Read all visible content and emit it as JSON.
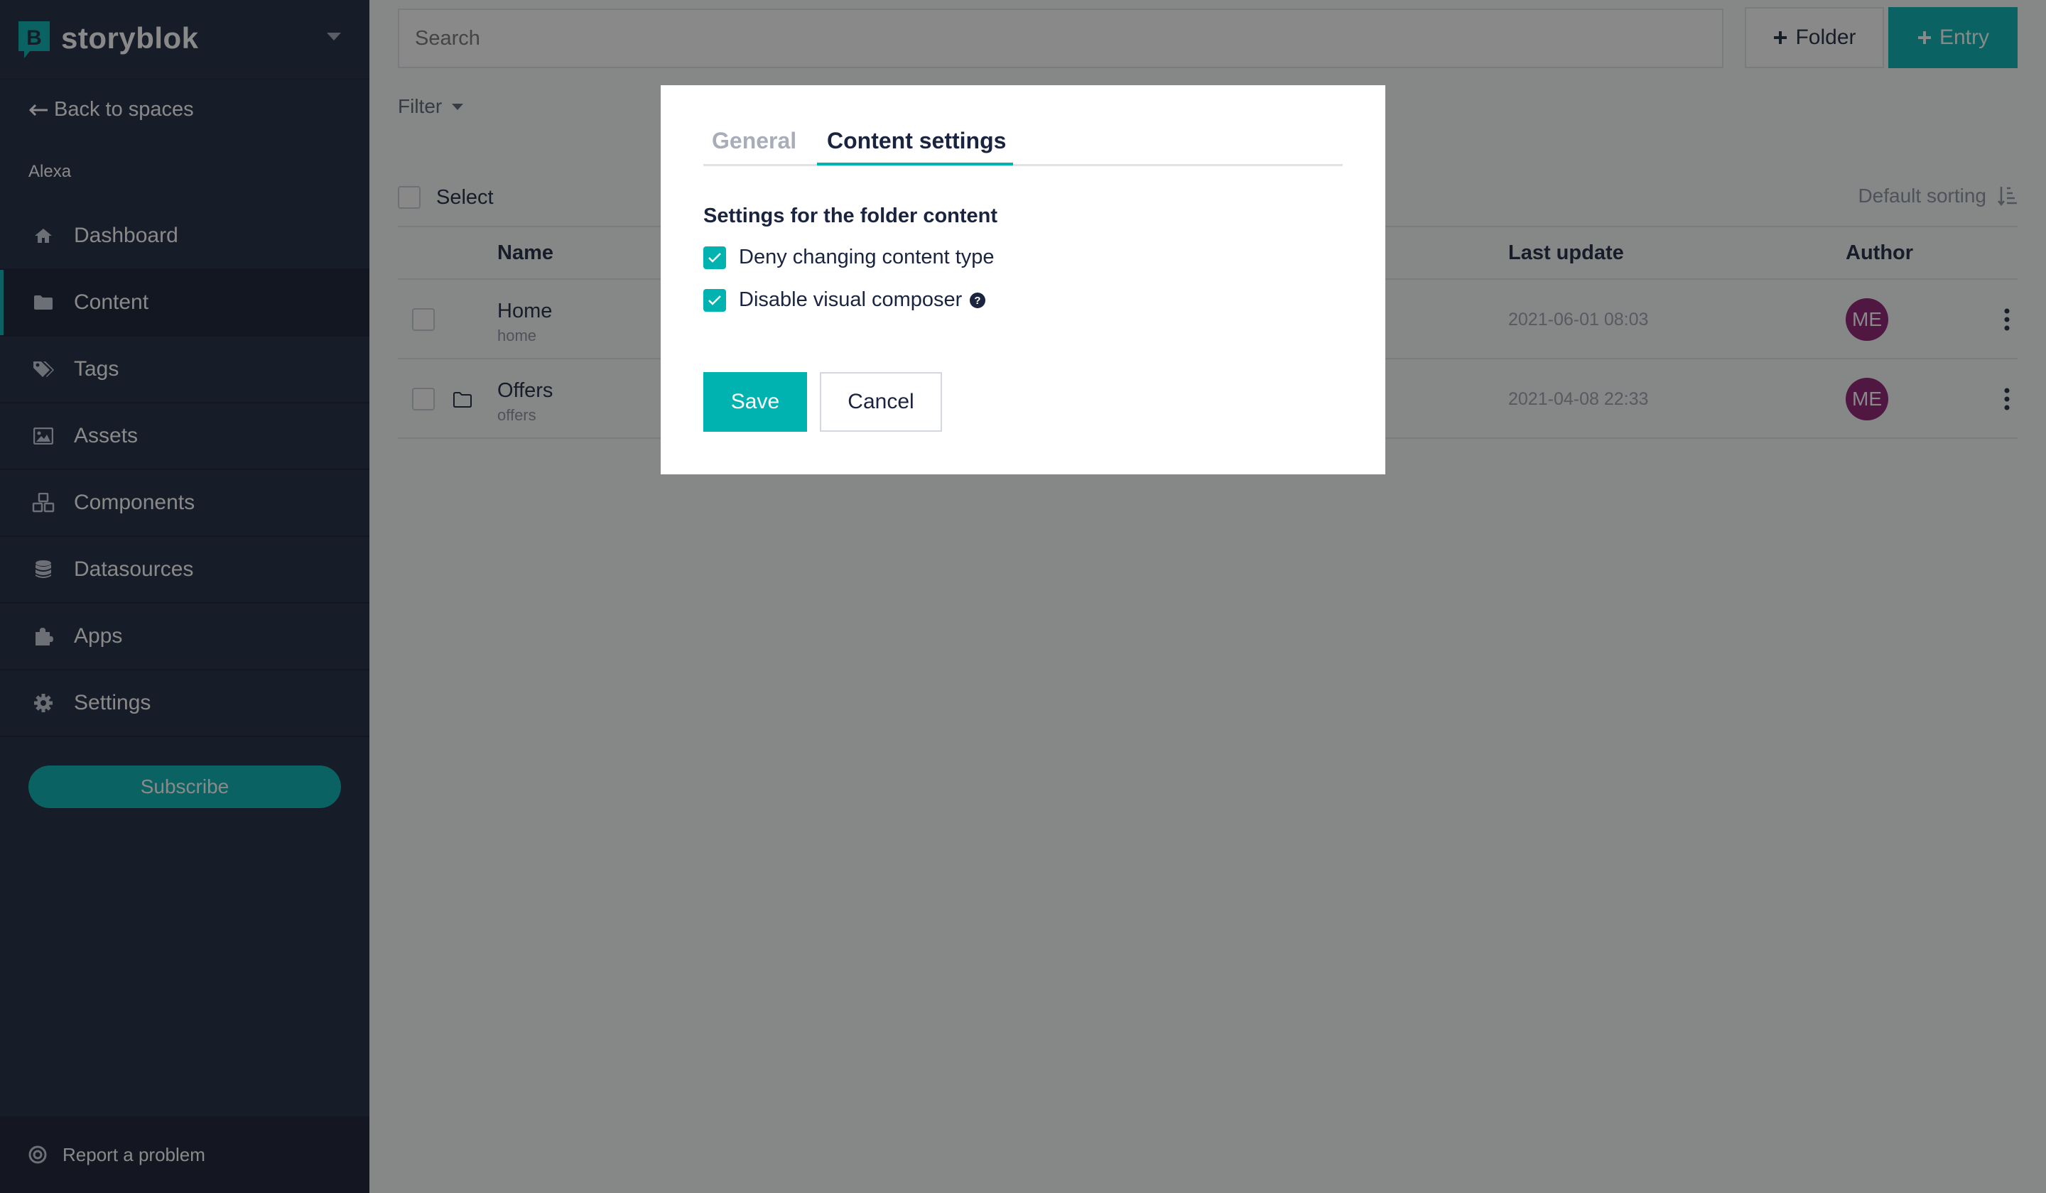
{
  "brand": {
    "name": "storyblok",
    "logo_letter": "B"
  },
  "sidebar": {
    "back_label": "Back to spaces",
    "space_name": "Alexa",
    "items": [
      {
        "label": "Dashboard",
        "icon": "home-icon"
      },
      {
        "label": "Content",
        "icon": "folder-icon",
        "active": true
      },
      {
        "label": "Tags",
        "icon": "tags-icon"
      },
      {
        "label": "Assets",
        "icon": "image-icon"
      },
      {
        "label": "Components",
        "icon": "cubes-icon"
      },
      {
        "label": "Datasources",
        "icon": "database-icon"
      },
      {
        "label": "Apps",
        "icon": "puzzle-icon"
      },
      {
        "label": "Settings",
        "icon": "gear-icon"
      }
    ],
    "subscribe_label": "Subscribe",
    "report_label": "Report a problem"
  },
  "toolbar": {
    "search_placeholder": "Search",
    "folder_label": "Folder",
    "entry_label": "Entry",
    "filter_label": "Filter"
  },
  "list": {
    "select_label": "Select",
    "sorting_label": "Default sorting",
    "columns": {
      "name": "Name",
      "last_update": "Last update",
      "author": "Author"
    },
    "rows": [
      {
        "title": "Home",
        "slug": "home",
        "updated": "2021-06-01 08:03",
        "author_initials": "ME",
        "type": "story"
      },
      {
        "title": "Offers",
        "slug": "offers",
        "updated": "2021-04-08 22:33",
        "author_initials": "ME",
        "type": "folder"
      }
    ]
  },
  "modal": {
    "tabs": [
      {
        "label": "General",
        "active": false
      },
      {
        "label": "Content settings",
        "active": true
      }
    ],
    "section_title": "Settings for the folder content",
    "options": [
      {
        "label": "Deny changing content type",
        "checked": true
      },
      {
        "label": "Disable visual composer",
        "checked": true,
        "help": true
      }
    ],
    "save_label": "Save",
    "cancel_label": "Cancel"
  },
  "colors": {
    "accent": "#00b3b0",
    "sidebar_bg": "#1b243f",
    "avatar_bg": "#8b1a6e",
    "overlay": "rgba(20,20,20,0.5)"
  }
}
